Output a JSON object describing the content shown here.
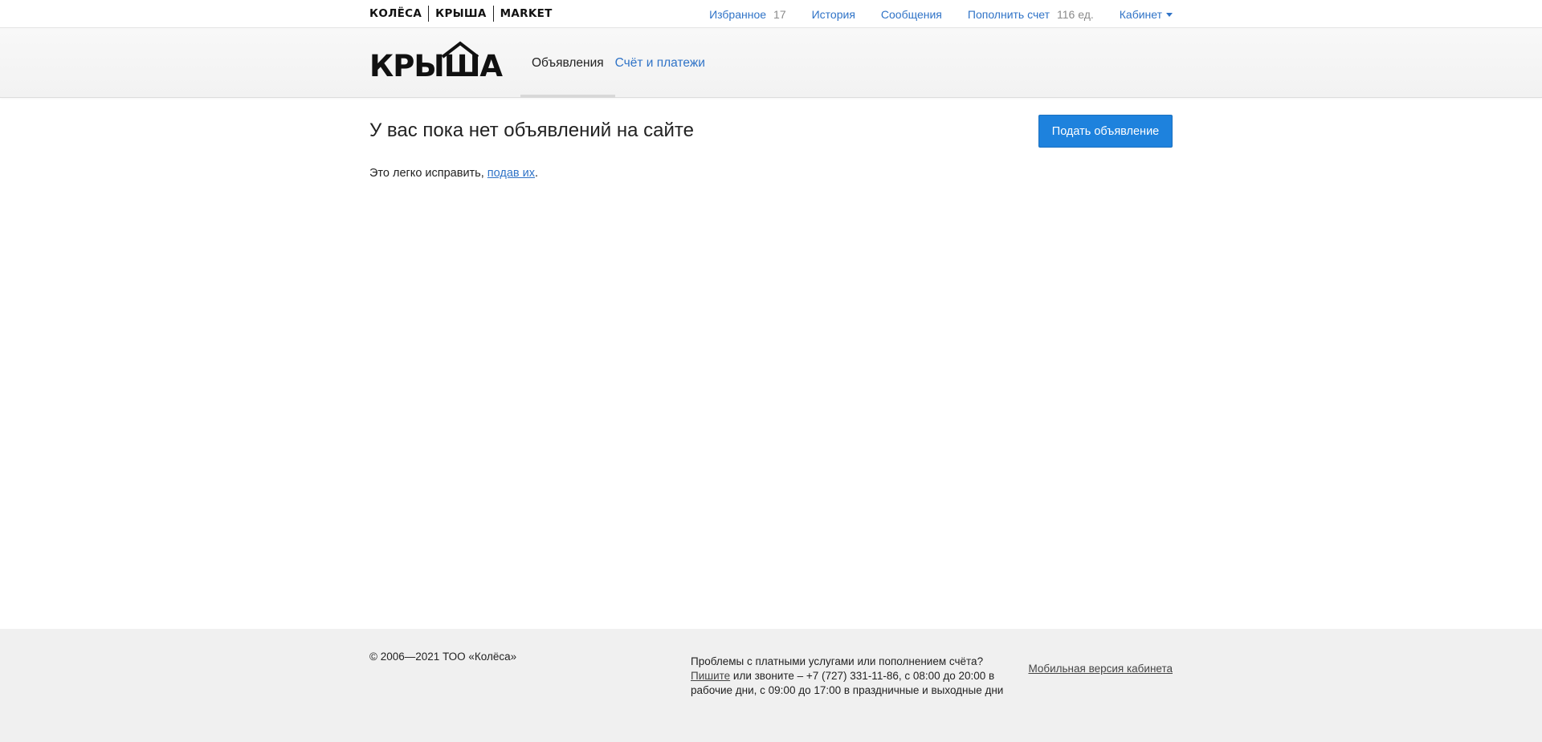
{
  "topbar": {
    "brands": [
      "КОЛЁСА",
      "КРЫША",
      "MARKET"
    ],
    "nav": {
      "favorites_label": "Избранное",
      "favorites_count": "17",
      "history_label": "История",
      "messages_label": "Сообщения",
      "topup_label": "Пополнить счет",
      "topup_balance": "116 ед.",
      "cabinet_label": "Кабинет"
    }
  },
  "header": {
    "logo_text": "КРЫША",
    "tabs": [
      {
        "label": "Объявления",
        "active": true
      },
      {
        "label": "Счёт и платежи",
        "active": false
      }
    ]
  },
  "main": {
    "title": "У вас пока нет объявлений на сайте",
    "submit_button": "Подать объявление",
    "hint_prefix": "Это легко исправить, ",
    "hint_link": "подав их",
    "hint_suffix": "."
  },
  "footer": {
    "copyright": "© 2006—2021 ТОО «Колёса»",
    "support_line1": "Проблемы с платными услугами или пополнением счёта?",
    "support_link": "Пишите",
    "support_rest": " или звоните – +7 (727) 331-11-86, с 08:00 до 20:00 в рабочие дни, с 09:00 до 17:00 в праздничные и выходные дни",
    "mobile_link": "Мобильная версия кабинета"
  },
  "colors": {
    "accent": "#1e82dd",
    "link": "#2f73c7",
    "footer_bg": "#f0f0f0"
  }
}
